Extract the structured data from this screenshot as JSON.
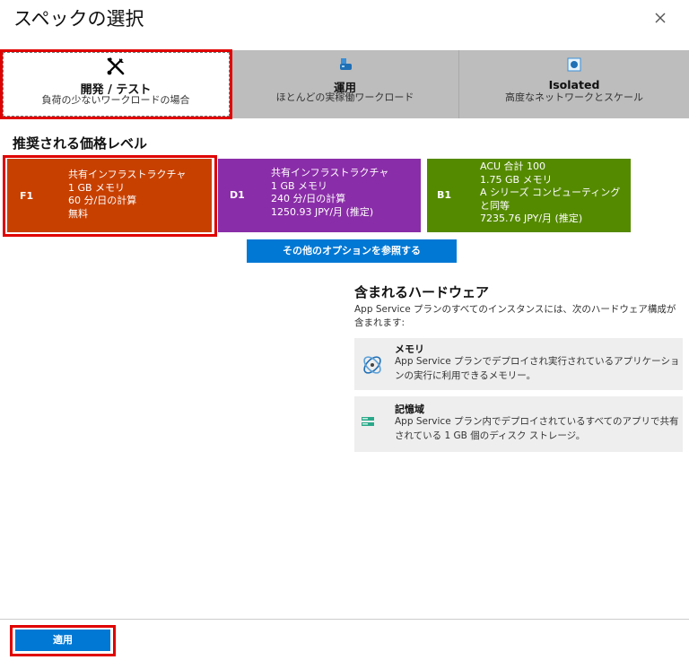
{
  "title": "スペックの選択",
  "tabs": [
    {
      "name": "開発 / テスト",
      "desc": "負荷の少ないワークロードの場合",
      "icon": "tools-icon"
    },
    {
      "name": "運用",
      "desc": "ほとんどの実稼働ワークロード",
      "icon": "production-icon"
    },
    {
      "name": "Isolated",
      "desc": "高度なネットワークとスケール",
      "icon": "isolated-network-icon"
    }
  ],
  "section_title": "推奨される価格レベル",
  "cards": [
    {
      "code": "F1",
      "lines": [
        "共有インフラストラクチャ",
        "1 GB メモリ",
        "60 分/日の計算",
        "無料"
      ],
      "color": "#c84000"
    },
    {
      "code": "D1",
      "lines": [
        "共有インフラストラクチャ",
        "1 GB メモリ",
        "240 分/日の計算",
        "1250.93 JPY/月 (推定)"
      ],
      "color": "#8a2da8"
    },
    {
      "code": "B1",
      "lines": [
        "ACU 合計 100",
        "1.75 GB メモリ",
        "A シリーズ コンピューティング",
        "と同等",
        "7235.76 JPY/月 (推定)"
      ],
      "color": "#548a00"
    }
  ],
  "more_options_label": "その他のオプションを参照する",
  "hardware": {
    "title": "含まれるハードウェア",
    "description": "App Service プランのすべてのインスタンスには、次のハードウェア構成が含まれます:",
    "items": [
      {
        "name": "メモリ",
        "text": "App Service プランでデプロイされ実行されているアプリケーションの実行に利用できるメモリー。",
        "icon": "memory-icon"
      },
      {
        "name": "記憶域",
        "text": "App Service プラン内でデプロイされているすべてのアプリで共有されている 1 GB 個のディスク ストレージ。",
        "icon": "storage-icon"
      }
    ]
  },
  "apply_label": "適用",
  "colors": {
    "accent": "#0078d4",
    "highlight": "#e00000"
  }
}
